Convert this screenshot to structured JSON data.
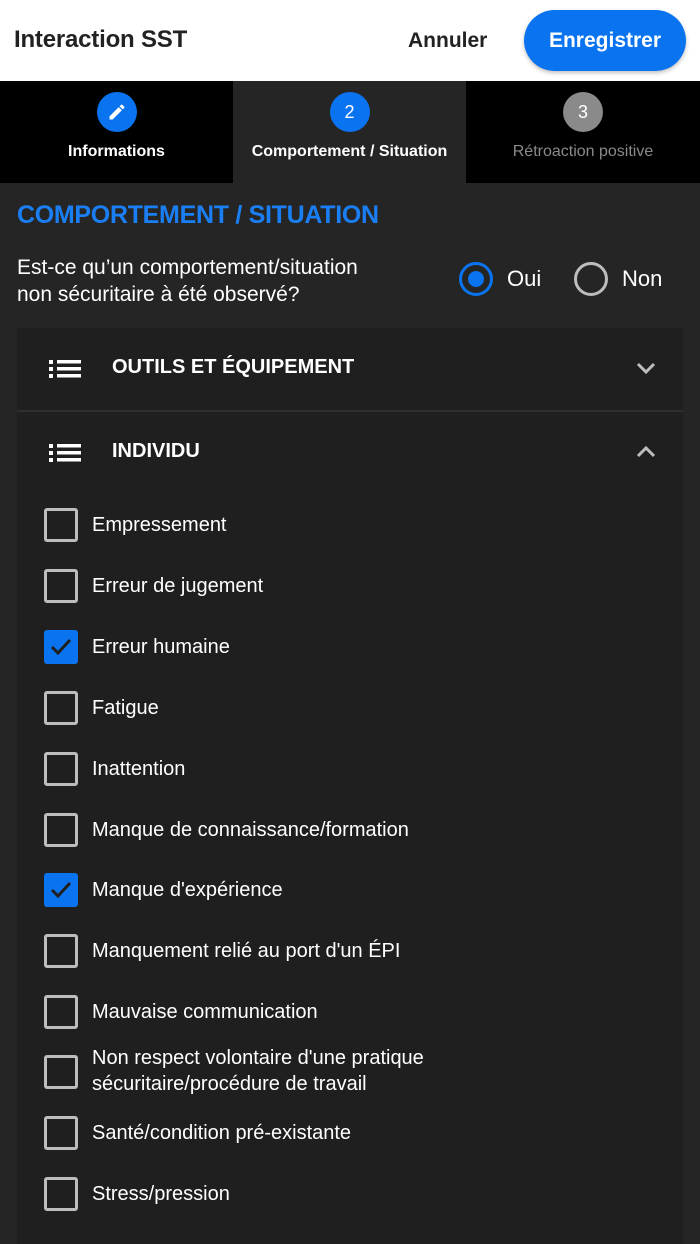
{
  "header": {
    "title": "Interaction SST",
    "cancel_label": "Annuler",
    "save_label": "Enregistrer"
  },
  "steps": [
    {
      "icon": "pencil-icon",
      "label": "Informations",
      "state": "done"
    },
    {
      "number": "2",
      "label": "Comportement / Situation",
      "state": "active"
    },
    {
      "number": "3",
      "label": "Rétroaction positive",
      "state": "upcoming"
    }
  ],
  "section": {
    "title": "COMPORTEMENT / SITUATION",
    "question_line1": "Est-ce qu’un comportement/situation",
    "question_line2": "non sécuritaire à été observé?",
    "options": [
      {
        "label": "Oui",
        "selected": true
      },
      {
        "label": "Non",
        "selected": false
      }
    ]
  },
  "accordions": [
    {
      "title": "OUTILS ET ÉQUIPEMENT",
      "icon": "list-icon",
      "expanded": false
    },
    {
      "title": "INDIVIDU",
      "icon": "list-icon",
      "expanded": true
    }
  ],
  "individu_items": [
    {
      "label": "Empressement",
      "checked": false
    },
    {
      "label": "Erreur de jugement",
      "checked": false
    },
    {
      "label": "Erreur humaine",
      "checked": true
    },
    {
      "label": "Fatigue",
      "checked": false
    },
    {
      "label": "Inattention",
      "checked": false
    },
    {
      "label": "Manque de connaissance/formation",
      "checked": false
    },
    {
      "label": "Manque d'expérience",
      "checked": true
    },
    {
      "label": "Manquement relié au port d'un ÉPI",
      "checked": false
    },
    {
      "label": "Mauvaise communication",
      "checked": false
    },
    {
      "label_line1": "Non respect volontaire d'une pratique",
      "label_line2": "sécuritaire/procédure de travail",
      "checked": false
    },
    {
      "label": "Santé/condition pré-existante",
      "checked": false
    },
    {
      "label": "Stress/pression",
      "checked": false
    }
  ],
  "colors": {
    "accent": "#0a74f0",
    "section_title": "#1a7ff5",
    "background": "#252525",
    "header_bg": "#ffffff"
  }
}
